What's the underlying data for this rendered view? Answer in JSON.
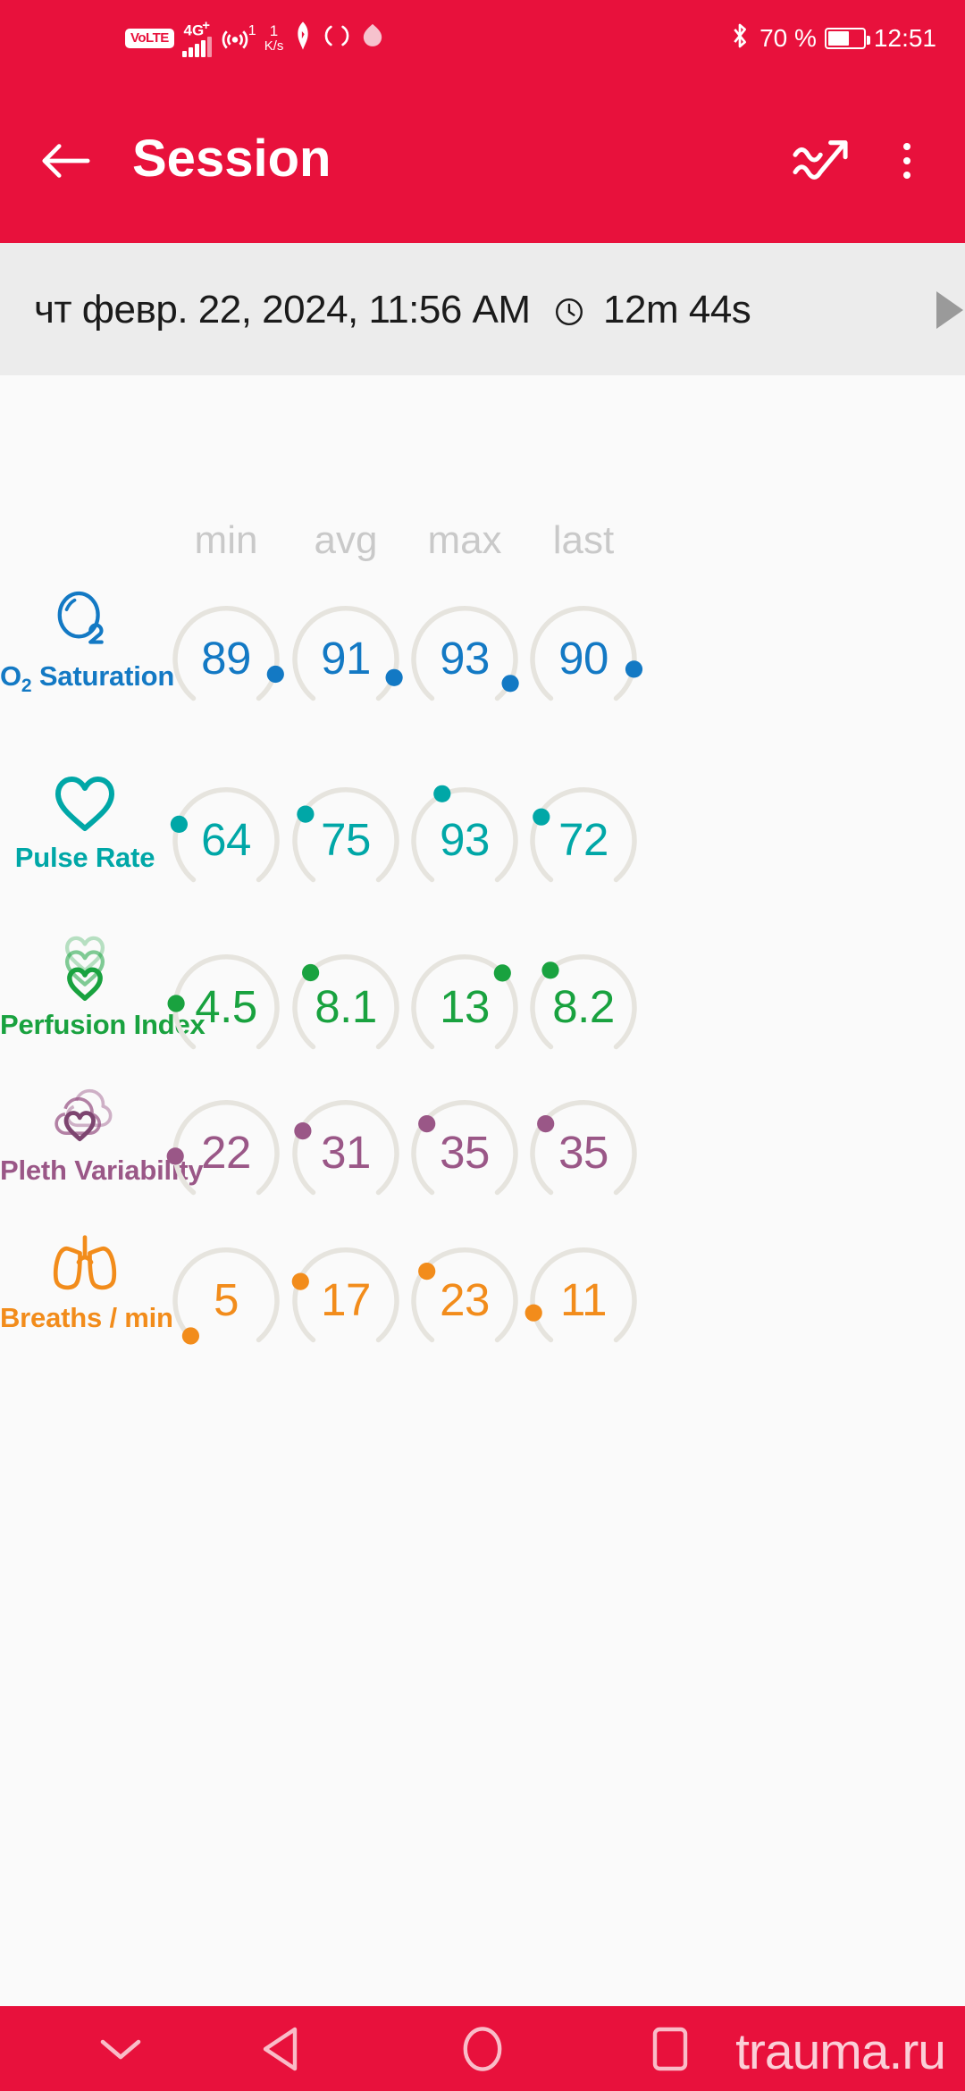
{
  "status_bar": {
    "volte": "VoLTE",
    "network_type": "4G",
    "network_plus": "+",
    "hotspot_count": "1",
    "data_rate_value": "1",
    "data_rate_unit": "K/s",
    "battery_percent": "70 %",
    "clock": "12:51",
    "icons": [
      "volte-icon",
      "signal-bars-icon",
      "hotspot-icon",
      "data-rate-icon",
      "nfc-icon",
      "sync-icon",
      "drop-icon",
      "bluetooth-icon",
      "battery-icon"
    ]
  },
  "app_bar": {
    "title": "Session",
    "back_icon": "arrow-left-icon",
    "trend_icon": "trend-chart-icon",
    "overflow_icon": "overflow-menu-icon"
  },
  "date_bar": {
    "date_text": "чт февр. 22, 2024, 11:56 AM",
    "clock_icon": "clock-icon",
    "duration": "12m 44s",
    "chevron_icon": "chevron-right-icon"
  },
  "columns": [
    "min",
    "avg",
    "max",
    "last"
  ],
  "colors": {
    "brand_red": "#E8113C",
    "o2": "#1379C4",
    "pulse": "#00A7A7",
    "perfusion": "#19A23F",
    "pleth": "#9A5787",
    "breaths": "#F28C1B",
    "track": "#E6E4DE"
  },
  "chart_data": {
    "type": "table",
    "title": "Session vitals summary",
    "columns": [
      "min",
      "avg",
      "max",
      "last"
    ],
    "rows": [
      {
        "label": "O2 Saturation",
        "icon": "o2-bubble-icon",
        "color": "#1379C4",
        "min": "89",
        "avg": "91",
        "max": "93",
        "last": "90",
        "values": [
          89,
          91,
          93,
          90
        ],
        "gauge_angles": [
          104,
          106,
          110,
          100
        ]
      },
      {
        "label": "Pulse Rate",
        "icon": "heart-outline-icon",
        "color": "#00A7A7",
        "min": "64",
        "avg": "75",
        "max": "93",
        "last": "72",
        "values": [
          64,
          75,
          93,
          72
        ],
        "gauge_angles": [
          -72,
          -52,
          -26,
          -58
        ]
      },
      {
        "label": "Perfusion Index",
        "icon": "triple-heart-icon",
        "color": "#19A23F",
        "min": "4.5",
        "avg": "8.1",
        "max": "13",
        "last": "8.2",
        "values": [
          4.5,
          8.1,
          13,
          8.2
        ],
        "gauge_angles": [
          -86,
          -30,
          42,
          -22
        ]
      },
      {
        "label": "Pleth Variability",
        "icon": "cloud-heart-icon",
        "color": "#9A5787",
        "min": "22",
        "avg": "31",
        "max": "35",
        "last": "35",
        "values": [
          22,
          31,
          35,
          35
        ],
        "gauge_angles": [
          -94,
          -48,
          -34,
          -34
        ]
      },
      {
        "label": "Breaths / min",
        "icon": "lungs-icon",
        "color": "#F28C1B",
        "min": "5",
        "avg": "17",
        "max": "23",
        "last": "11",
        "values": [
          5,
          17,
          23,
          11
        ],
        "gauge_angles": [
          -134,
          -62,
          -34,
          -104
        ]
      }
    ]
  },
  "nav_bar": {
    "hide_icon": "chevron-down-icon",
    "back_icon": "triangle-back-icon",
    "home_icon": "circle-home-icon",
    "recent_icon": "square-recents-icon",
    "watermark": "trauma.ru"
  }
}
